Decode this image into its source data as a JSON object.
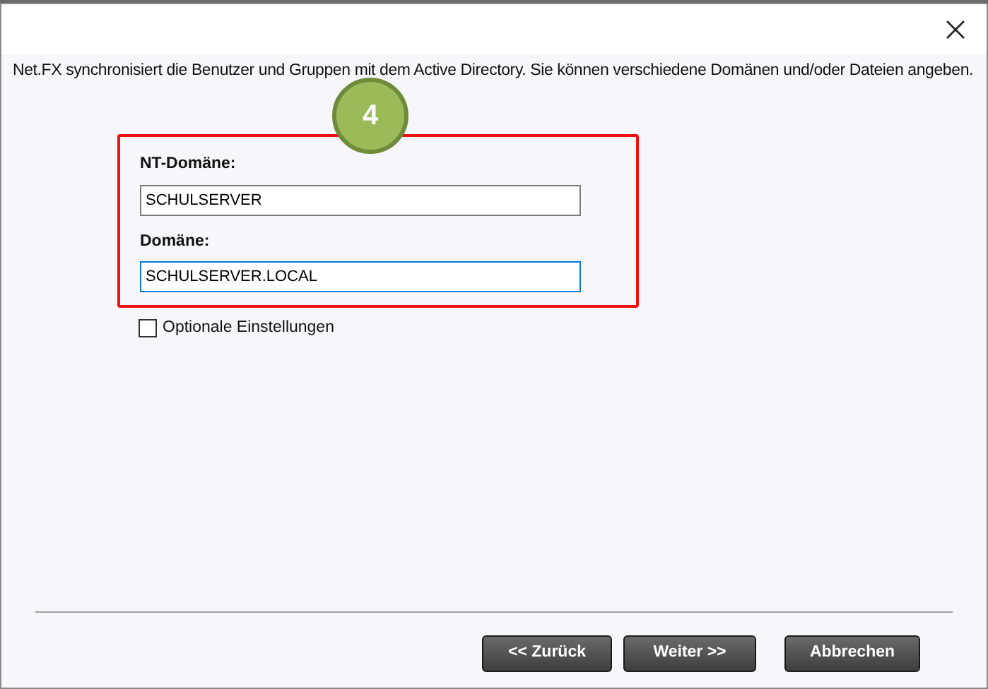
{
  "description": "Net.FX synchronisiert die Benutzer und Gruppen mit dem Active Directory. Sie können verschiedene Domänen und/oder Dateien angeben.",
  "step_badge": "4",
  "fields": [
    {
      "label": "NT-Domäne:",
      "value": "SCHULSERVER",
      "focused": false
    },
    {
      "label": "Domäne:",
      "value": "SCHULSERVER.LOCAL",
      "focused": true
    }
  ],
  "option": {
    "label": "Optionale Einstellungen",
    "checked": false
  },
  "buttons": [
    "<< Zurück",
    "Weiter >>",
    "Abbrechen"
  ]
}
